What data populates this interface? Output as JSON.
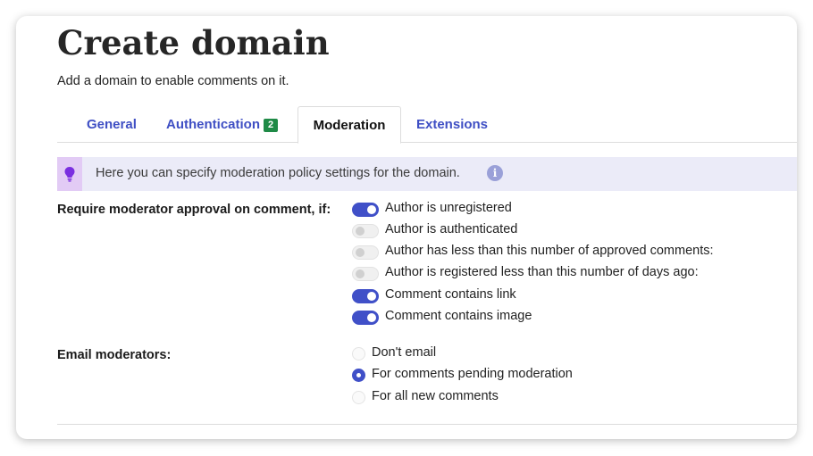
{
  "header": {
    "title": "Create domain",
    "subtitle": "Add a domain to enable comments on it."
  },
  "tabs": [
    {
      "label": "General",
      "active": false
    },
    {
      "label": "Authentication",
      "badge": "2",
      "active": false
    },
    {
      "label": "Moderation",
      "active": true
    },
    {
      "label": "Extensions",
      "active": false
    }
  ],
  "info": {
    "icon": "lightbulb-icon",
    "text": "Here you can specify moderation policy settings for the domain.",
    "help_icon": "i"
  },
  "moderation": {
    "label": "Require moderator approval on comment, if:",
    "options": [
      {
        "label": "Author is unregistered",
        "checked": true
      },
      {
        "label": "Author is authenticated",
        "checked": false
      },
      {
        "label": "Author has less than this number of approved comments:",
        "checked": false
      },
      {
        "label": "Author is registered less than this number of days ago:",
        "checked": false
      },
      {
        "label": "Comment contains link",
        "checked": true
      },
      {
        "label": "Comment contains image",
        "checked": true
      }
    ]
  },
  "email": {
    "label": "Email moderators:",
    "options": [
      {
        "label": "Don't email",
        "selected": false
      },
      {
        "label": "For comments pending moderation",
        "selected": true
      },
      {
        "label": "For all new comments",
        "selected": false
      }
    ]
  },
  "colors": {
    "accent": "#4050c8",
    "link": "#3f4fc4",
    "badge": "#1f8a46",
    "info_bg": "#ebebf8",
    "bulb_bg": "#e2cbf5"
  }
}
